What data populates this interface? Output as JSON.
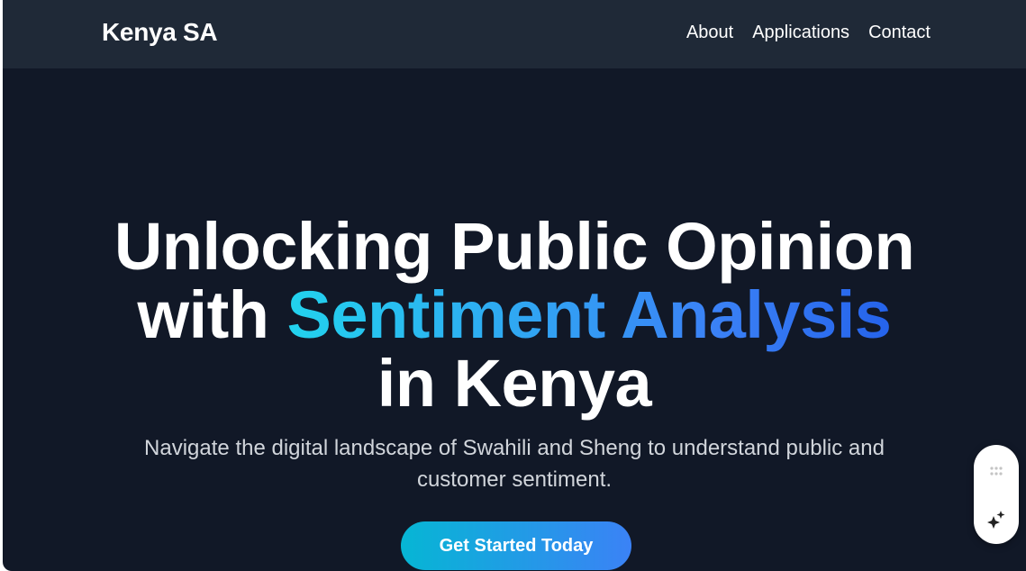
{
  "navbar": {
    "brand": "Kenya SA",
    "links": [
      "About",
      "Applications",
      "Contact"
    ]
  },
  "hero": {
    "headline_line1": "Unlocking Public Opinion",
    "headline_line2_prefix": "with ",
    "headline_line2_highlight": "Sentiment Analysis",
    "headline_line3": "in Kenya",
    "subtitle": "Navigate the digital landscape of Swahili and Sheng to understand public and customer sentiment.",
    "cta_label": "Get Started Today"
  },
  "widget": {
    "icons": [
      "grip-icon",
      "sparkle-icon"
    ]
  },
  "colors": {
    "page_bg": "#111827",
    "navbar_bg": "#1f2937",
    "gradient_start": "#22d3ee",
    "gradient_end": "#3b82f6",
    "subtitle": "#d1d5db"
  }
}
